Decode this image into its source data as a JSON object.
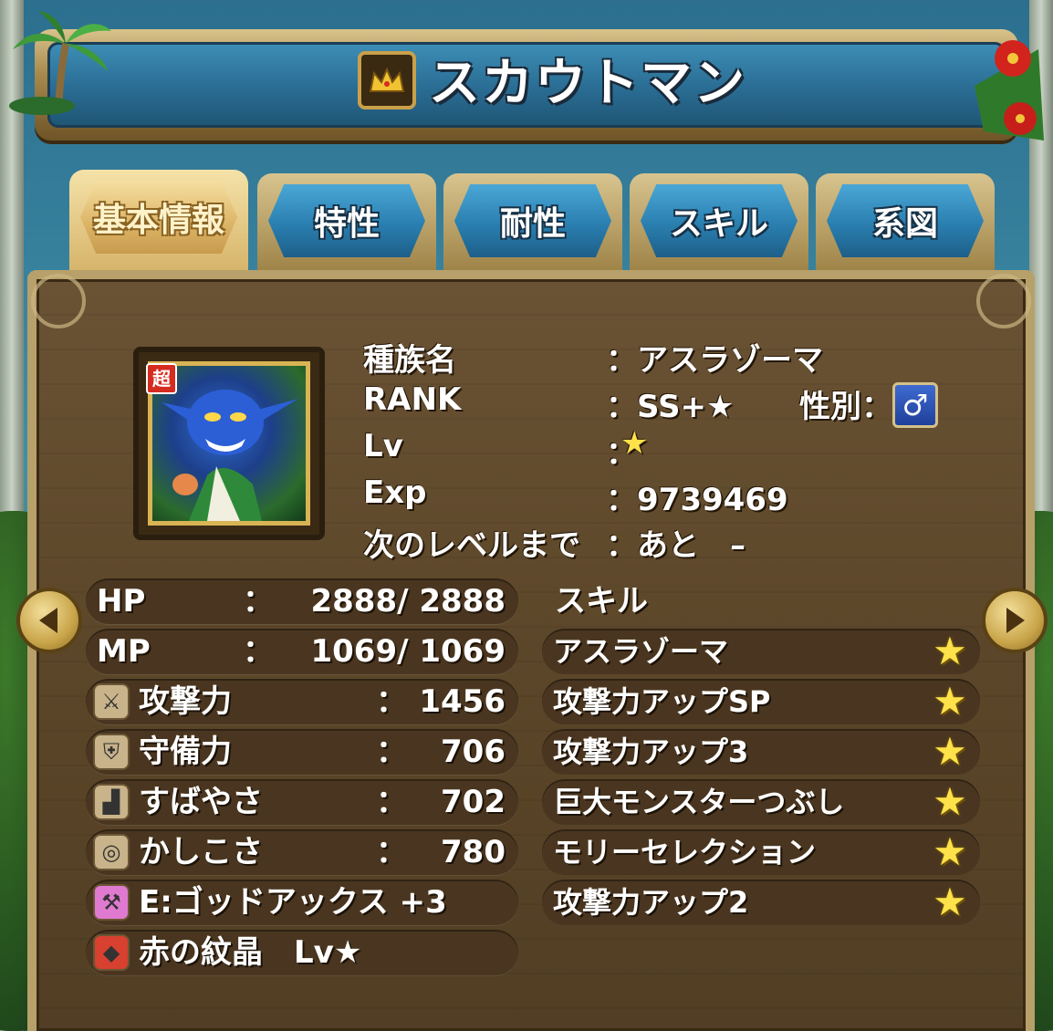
{
  "header": {
    "title": "スカウトマン",
    "icon": "crown-icon"
  },
  "tabs": [
    {
      "label": "基本情報",
      "active": true
    },
    {
      "label": "特性",
      "active": false
    },
    {
      "label": "耐性",
      "active": false
    },
    {
      "label": "スキル",
      "active": false
    },
    {
      "label": "系図",
      "active": false
    }
  ],
  "monster": {
    "super_badge": "超",
    "species_label": "種族名",
    "species_value": "：アスラゾーマ",
    "rank_label": "RANK",
    "rank_value": "：SS+★",
    "gender_label": "性別：",
    "gender_symbol": "♂",
    "lv_label": "Lv",
    "lv_value": "：",
    "lv_star": "★",
    "exp_label": "Exp",
    "exp_value": "：9739469",
    "next_label": "次のレベルまで",
    "next_value": "：あと　–"
  },
  "stats": {
    "hp": {
      "label": "HP",
      "sep": "：",
      "value": "2888/ 2888"
    },
    "mp": {
      "label": "MP",
      "sep": "：",
      "value": "1069/ 1069"
    },
    "attack": {
      "label": "攻撃力",
      "sep": "：",
      "value": "1456",
      "icon": "sword-icon"
    },
    "defense": {
      "label": "守備力",
      "sep": "：",
      "value": "706",
      "icon": "shield-icon"
    },
    "speed": {
      "label": "すばやさ",
      "sep": "：",
      "value": "702",
      "icon": "boots-icon"
    },
    "wisdom": {
      "label": "かしこさ",
      "sep": "：",
      "value": "780",
      "icon": "necklace-icon"
    },
    "equipment": {
      "label": "E:ゴッドアックス +3",
      "icon": "axe-icon"
    },
    "crest": {
      "label": "赤の紋晶　Lv★",
      "icon": "red-crest-icon"
    }
  },
  "skills": {
    "title": "スキル",
    "items": [
      {
        "name": "アスラゾーマ",
        "star": "★"
      },
      {
        "name": "攻撃力アップSP",
        "star": "★"
      },
      {
        "name": "攻撃力アップ3",
        "star": "★"
      },
      {
        "name": "巨大モンスターつぶし",
        "star": "★"
      },
      {
        "name": "モリーセレクション",
        "star": "★"
      },
      {
        "name": "攻撃力アップ2",
        "star": "★"
      }
    ]
  },
  "nav": {
    "prev_icon": "triangle-left-icon",
    "next_icon": "triangle-right-icon"
  },
  "colors": {
    "title_blue": "#2a6c93",
    "wood": "#5c4629",
    "gold": "#c9a04a",
    "star": "#ffe24a"
  }
}
